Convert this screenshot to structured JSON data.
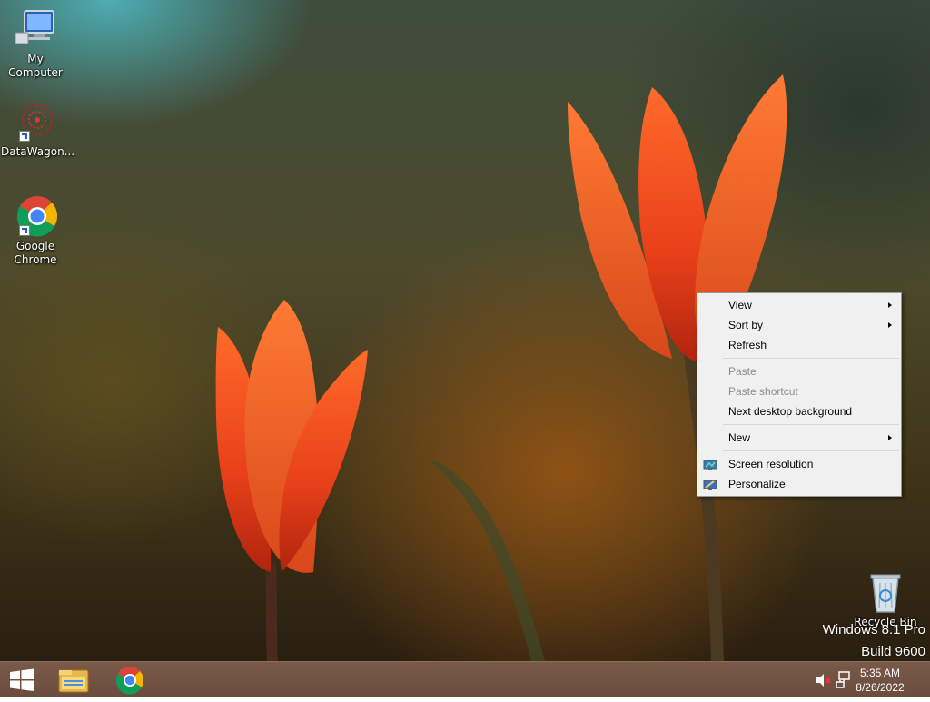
{
  "desktop_icons": [
    {
      "label": "My Computer",
      "icon": "computer-icon"
    },
    {
      "label": "DataWagon...",
      "icon": "datawagon-icon"
    },
    {
      "label": "Google Chrome",
      "icon": "chrome-icon"
    },
    {
      "label": "Recycle Bin",
      "icon": "recycle-bin-icon"
    }
  ],
  "watermark": {
    "line1": "Windows 8.1 Pro",
    "line2": "Build 9600"
  },
  "context_menu": {
    "view": "View",
    "sort_by": "Sort by",
    "refresh": "Refresh",
    "paste": "Paste",
    "paste_shortcut": "Paste shortcut",
    "next_background": "Next desktop background",
    "new": "New",
    "screen_resolution": "Screen resolution",
    "personalize": "Personalize"
  },
  "taskbar": {
    "time": "5:35 AM",
    "date": "8/26/2022",
    "apps": [
      "start-icon",
      "file-explorer-icon",
      "chrome-icon"
    ],
    "tray": [
      "volume-muted-icon",
      "network-icon"
    ]
  },
  "colors": {
    "taskbar": "#6e4f3f",
    "menu_bg": "#f0f0f0",
    "menu_disabled": "#8d8d8d"
  }
}
